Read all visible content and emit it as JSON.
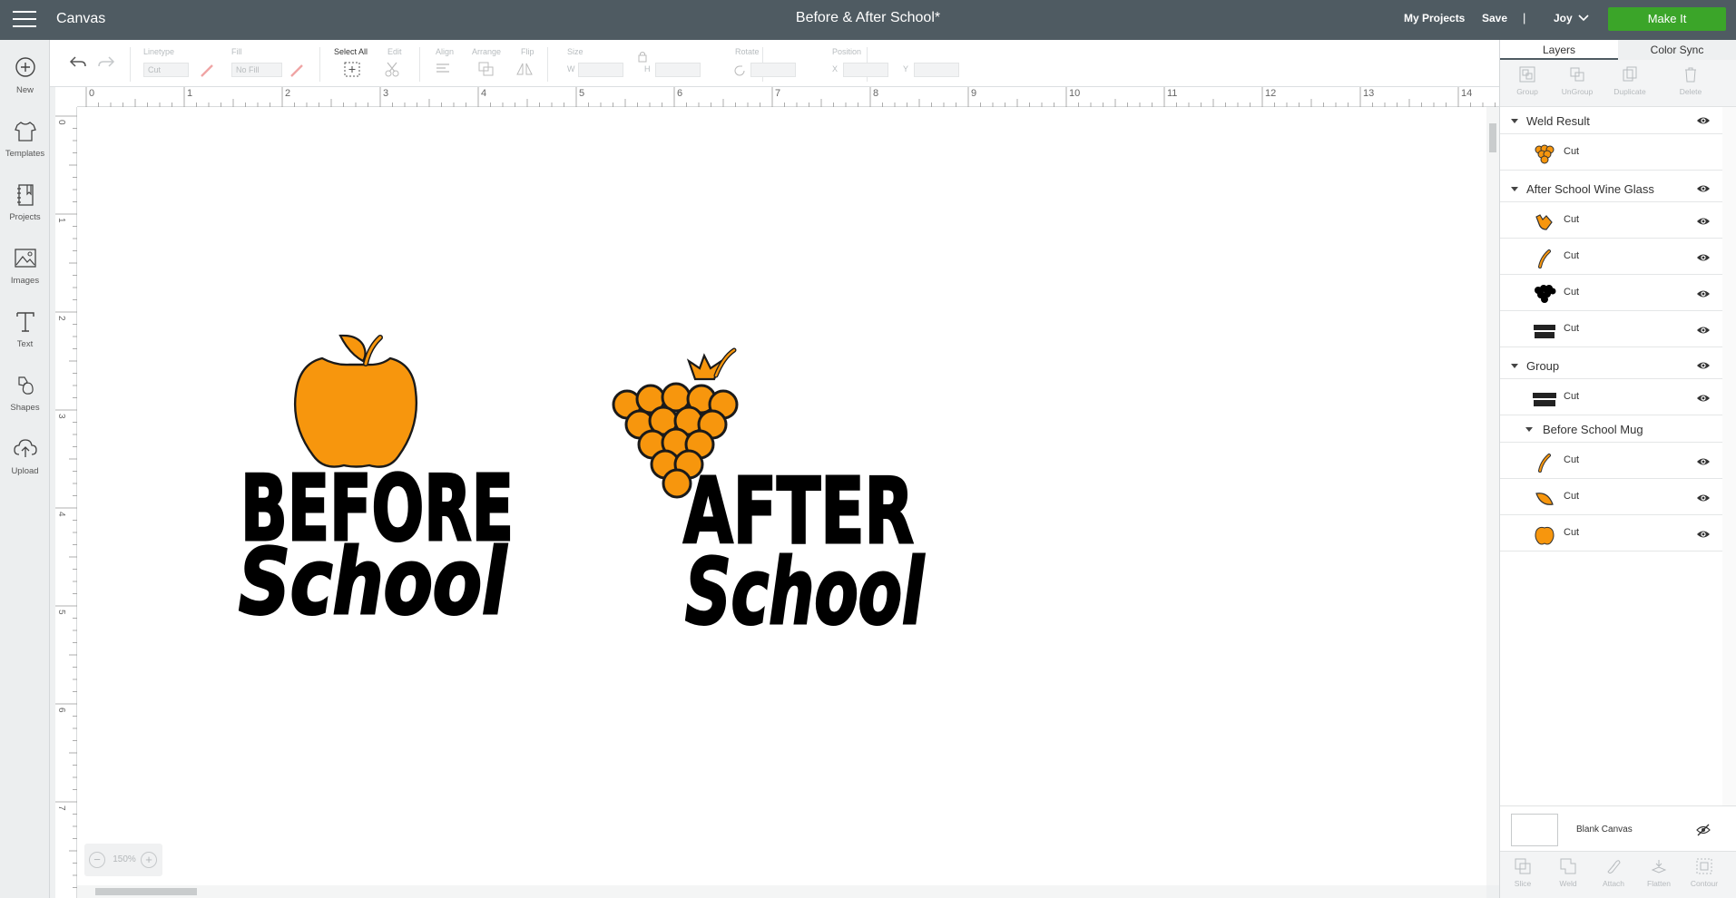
{
  "topbar": {
    "app_title": "Canvas",
    "project_title": "Before & After School*",
    "my_projects": "My Projects",
    "save": "Save",
    "separator": "|",
    "user": "Joy",
    "make_it": "Make It"
  },
  "colors": {
    "topbar_bg": "#4f5b62",
    "make_it": "#3ba529",
    "orange": "#f7960d",
    "black": "#000000"
  },
  "leftbar": {
    "items": [
      {
        "label": "New",
        "icon": "plus-circle-icon"
      },
      {
        "label": "Templates",
        "icon": "tshirt-icon"
      },
      {
        "label": "Projects",
        "icon": "notebook-icon"
      },
      {
        "label": "Images",
        "icon": "image-icon"
      },
      {
        "label": "Text",
        "icon": "text-t-icon"
      },
      {
        "label": "Shapes",
        "icon": "shapes-icon"
      },
      {
        "label": "Upload",
        "icon": "cloud-upload-icon"
      }
    ]
  },
  "toolbar": {
    "linetype_label": "Linetype",
    "linetype_value": "Cut",
    "fill_label": "Fill",
    "fill_value": "No Fill",
    "select_all": "Select All",
    "edit": "Edit",
    "align": "Align",
    "arrange": "Arrange",
    "flip": "Flip",
    "size": "Size",
    "w": "W",
    "h": "H",
    "rotate": "Rotate",
    "position": "Position",
    "x": "X",
    "y": "Y"
  },
  "ruler": {
    "top_ticks": [
      "0",
      "1",
      "2",
      "3",
      "4",
      "5",
      "6",
      "7",
      "8",
      "9",
      "10",
      "11",
      "12",
      "13",
      "14"
    ],
    "left_ticks": [
      "0",
      "1",
      "2",
      "3",
      "4",
      "5",
      "6",
      "7"
    ]
  },
  "canvas": {
    "zoom": "150%",
    "zoom_minus": "−",
    "zoom_plus": "+"
  },
  "right_panel": {
    "tabs": [
      "Layers",
      "Color Sync"
    ],
    "top_actions": [
      "Group",
      "UnGroup",
      "Duplicate",
      "Delete"
    ],
    "layers": {
      "weld_result": {
        "name": "Weld Result",
        "items": [
          "Cut"
        ]
      },
      "wine_glass": {
        "name": "After School Wine Glass",
        "items": [
          "Cut",
          "Cut",
          "Cut",
          "Cut"
        ]
      },
      "group": {
        "name": "Group",
        "items": [
          "Cut"
        ]
      },
      "mug": {
        "name": "Before School Mug",
        "items": [
          "Cut",
          "Cut",
          "Cut"
        ]
      }
    },
    "blank_canvas": "Blank Canvas",
    "bottom_actions": [
      "Slice",
      "Weld",
      "Attach",
      "Flatten",
      "Contour"
    ]
  }
}
